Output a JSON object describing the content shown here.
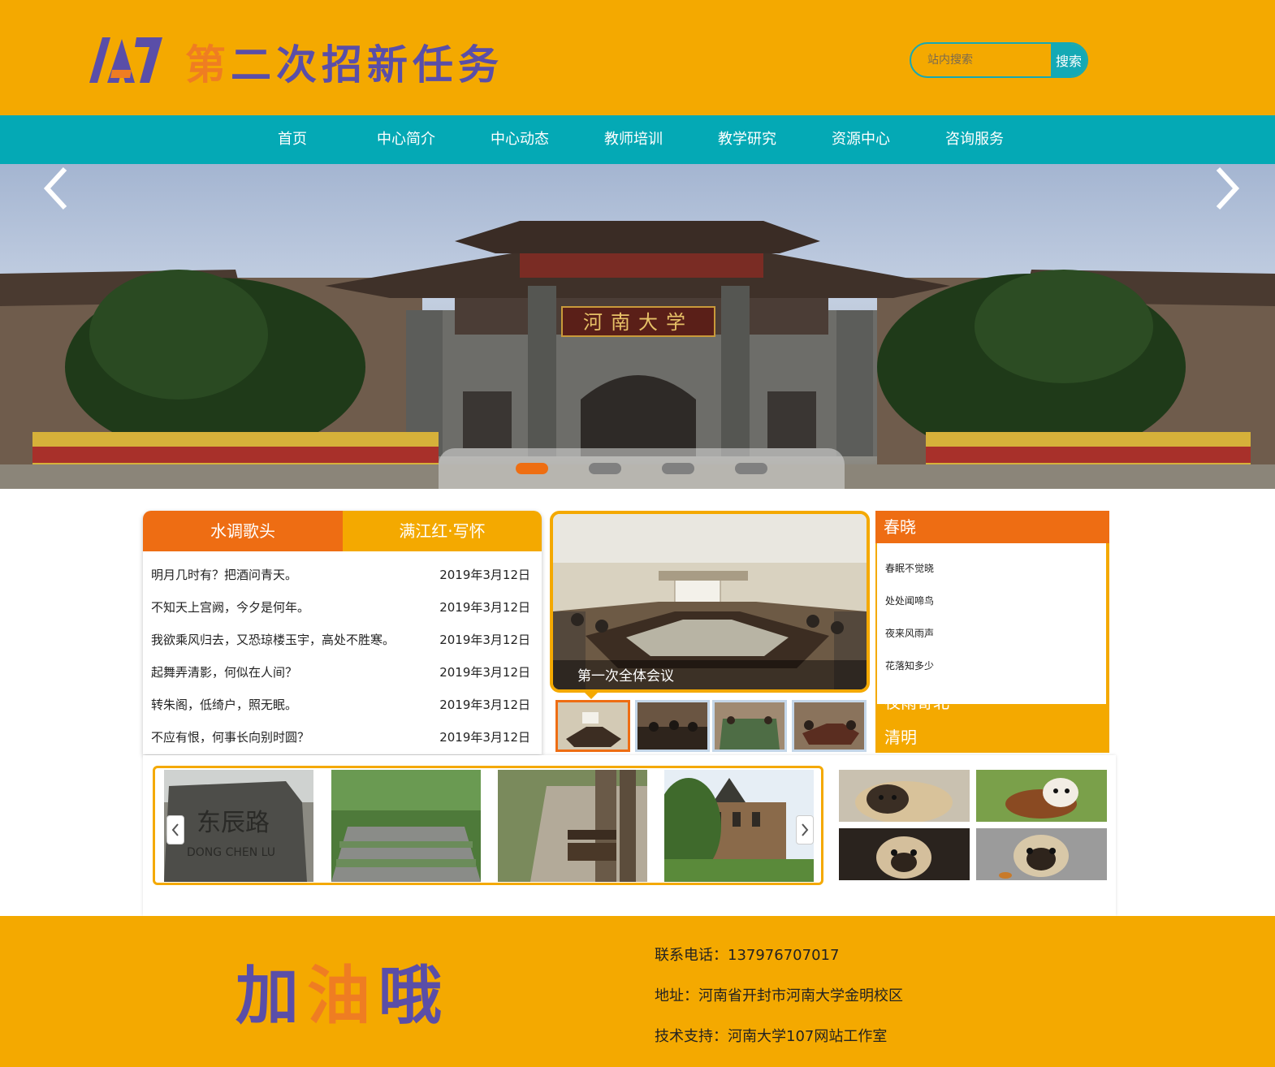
{
  "header": {
    "logo_text": "107",
    "title": "第二次招新任务",
    "search_placeholder": "站内搜索",
    "search_button": "搜索"
  },
  "nav": {
    "items": [
      "首页",
      "中心简介",
      "中心动态",
      "教师培训",
      "教学研究",
      "资源中心",
      "咨询服务"
    ]
  },
  "hero": {
    "gate_sign": "河南大学",
    "slide_count": 4,
    "active_slide": 0
  },
  "tabs": {
    "labels": [
      "水调歌头",
      "满江红·写怀"
    ],
    "active": 0,
    "rows": [
      {
        "title": "明月几时有？把酒问青天。",
        "date": "2019年3月12日"
      },
      {
        "title": "不知天上宫阙，今夕是何年。",
        "date": "2019年3月12日"
      },
      {
        "title": "我欲乘风归去，又恐琼楼玉宇，高处不胜寒。",
        "date": "2019年3月12日"
      },
      {
        "title": "起舞弄清影，何似在人间？",
        "date": "2019年3月12日"
      },
      {
        "title": "转朱阁，低绮户，照无眠。",
        "date": "2019年3月12日"
      },
      {
        "title": "不应有恨，何事长向别时圆？",
        "date": "2019年3月12日"
      }
    ]
  },
  "gallery": {
    "caption": "第一次全体会议",
    "thumb_count": 4,
    "active_thumb": 0
  },
  "side": {
    "heading": "春晓",
    "lines": [
      "春眠不觉晓",
      "处处闻啼鸟",
      "夜来风雨声",
      "花落知多少"
    ],
    "links": [
      "夜雨寄北",
      "清明"
    ]
  },
  "carousel": {
    "sign_text": "东辰路",
    "sign_sub": "DONG CHEN LU"
  },
  "footer": {
    "slogan": "加油哦",
    "phone": "联系电话：137976707017",
    "address": "地址：河南省开封市河南大学金明校区",
    "support": "技术支持：河南大学107网站工作室"
  },
  "colors": {
    "brand_orange": "#f4a900",
    "accent_orange": "#ee6d13",
    "teal": "#04a9b5",
    "purple": "#5a4ea8"
  }
}
